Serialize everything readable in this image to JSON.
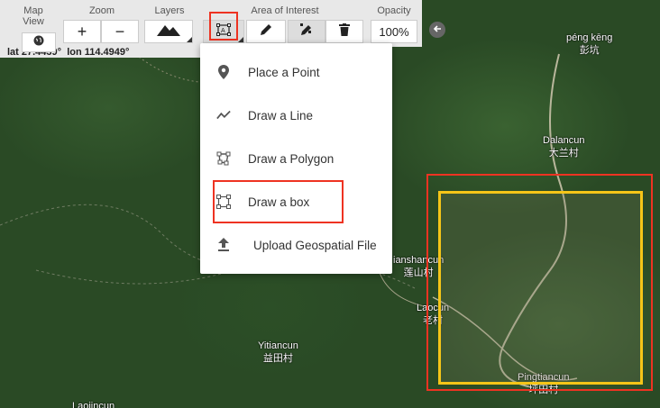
{
  "toolbar": {
    "map_view_label": "Map View",
    "zoom_label": "Zoom",
    "layers_label": "Layers",
    "aoi_label": "Area of Interest",
    "opacity_label": "Opacity",
    "zoom_in": "+",
    "zoom_out": "−",
    "opacity_value": "100%",
    "coords_lat": "lat 27.4439°",
    "coords_lon": "lon 114.4949°"
  },
  "menu": {
    "items": [
      {
        "label": "Place a Point",
        "icon": "map-pin-icon"
      },
      {
        "label": "Draw a Line",
        "icon": "line-chart-icon"
      },
      {
        "label": "Draw a Polygon",
        "icon": "polygon-icon"
      },
      {
        "label": "Draw a box",
        "icon": "box-select-icon"
      },
      {
        "label": "Upload Geospatial File",
        "icon": "upload-icon"
      }
    ]
  },
  "places": {
    "peng_keng": "péng kēng",
    "peng_keng_cn": "彭坑",
    "dalancun": "Dalancun",
    "dalancun_cn": "大兰村",
    "lianshancun": "ianshancun",
    "lianshancun_cn": "莲山村",
    "laocun": "Laocun",
    "laocun_cn": "老村",
    "yitiancun": "Yitiancun",
    "yitiancun_cn": "益田村",
    "pingtiancun": "Pingtiancun",
    "pingtiancun_cn": "坪田村",
    "bottom_left": "Laojincun"
  },
  "colors": {
    "highlight": "#ee3322",
    "aoi_box": "#f5c518"
  }
}
